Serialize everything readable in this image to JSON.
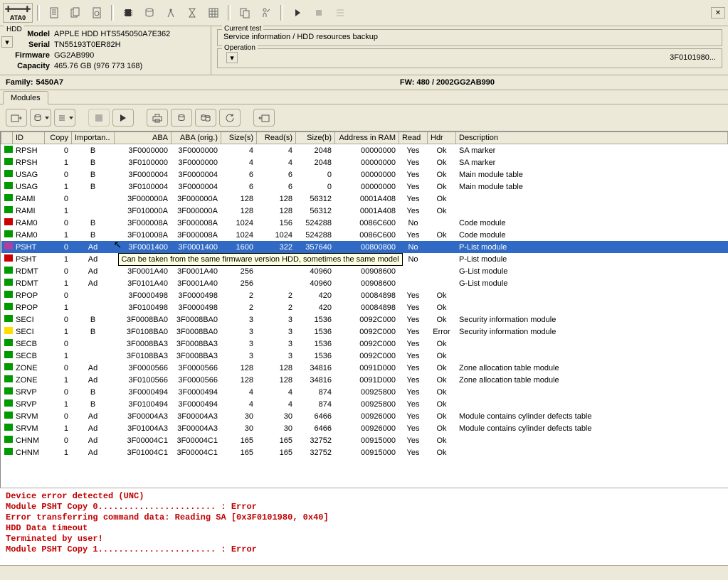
{
  "ata_btn": "ATA0",
  "hdd": {
    "label": "HDD",
    "model_k": "Model",
    "model": "APPLE HDD HTS545050A7E362",
    "serial_k": "Serial",
    "serial": "TN55193T0ER82H",
    "fw_k": "Firmware",
    "fw": "GG2AB990",
    "cap_k": "Capacity",
    "cap": "465.76 GB (976 773 168)"
  },
  "current_test": {
    "legend": "Current test",
    "value": "Service information / HDD resources backup"
  },
  "operation": {
    "legend": "Operation",
    "right": "3F0101980..."
  },
  "family": {
    "label": "Family:",
    "value": "5450A7",
    "fw_label": "FW:",
    "fw_value": "480 / 2002GG2AB990"
  },
  "tab_modules": "Modules",
  "columns": {
    "id": "ID",
    "copy": "Copy",
    "imp": "Importan..",
    "aba": "ABA",
    "abao": "ABA (orig.)",
    "ss": "Size(s)",
    "rs": "Read(s)",
    "sb": "Size(b)",
    "addr": "Address in RAM",
    "read": "Read",
    "hdr": "Hdr",
    "desc": "Description"
  },
  "tooltip": "Can be taken from the same firmware version HDD, sometimes the same model",
  "rows": [
    {
      "c": "green",
      "id": "RPSH",
      "copy": "0",
      "imp": "B",
      "aba": "3F0000000",
      "abao": "3F0000000",
      "ss": "4",
      "rs": "4",
      "sb": "2048",
      "addr": "00000000",
      "read": "Yes",
      "hdr": "Ok",
      "desc": "SA marker"
    },
    {
      "c": "green",
      "id": "RPSH",
      "copy": "1",
      "imp": "B",
      "aba": "3F0100000",
      "abao": "3F0000000",
      "ss": "4",
      "rs": "4",
      "sb": "2048",
      "addr": "00000000",
      "read": "Yes",
      "hdr": "Ok",
      "desc": "SA marker"
    },
    {
      "c": "green",
      "id": "USAG",
      "copy": "0",
      "imp": "B",
      "aba": "3F0000004",
      "abao": "3F0000004",
      "ss": "6",
      "rs": "6",
      "sb": "0",
      "addr": "00000000",
      "read": "Yes",
      "hdr": "Ok",
      "desc": "Main module table"
    },
    {
      "c": "green",
      "id": "USAG",
      "copy": "1",
      "imp": "B",
      "aba": "3F0100004",
      "abao": "3F0000004",
      "ss": "6",
      "rs": "6",
      "sb": "0",
      "addr": "00000000",
      "read": "Yes",
      "hdr": "Ok",
      "desc": "Main module table"
    },
    {
      "c": "green",
      "id": "RAMI",
      "copy": "0",
      "imp": "",
      "aba": "3F000000A",
      "abao": "3F000000A",
      "ss": "128",
      "rs": "128",
      "sb": "56312",
      "addr": "0001A408",
      "read": "Yes",
      "hdr": "Ok",
      "desc": ""
    },
    {
      "c": "green",
      "id": "RAMI",
      "copy": "1",
      "imp": "",
      "aba": "3F010000A",
      "abao": "3F000000A",
      "ss": "128",
      "rs": "128",
      "sb": "56312",
      "addr": "0001A408",
      "read": "Yes",
      "hdr": "Ok",
      "desc": ""
    },
    {
      "c": "red",
      "id": "RAM0",
      "copy": "0",
      "imp": "B",
      "aba": "3F000008A",
      "abao": "3F000008A",
      "ss": "1024",
      "rs": "156",
      "sb": "524288",
      "addr": "0086C600",
      "read": "No",
      "hdr": "",
      "desc": "Code module"
    },
    {
      "c": "green",
      "id": "RAM0",
      "copy": "1",
      "imp": "B",
      "aba": "3F010008A",
      "abao": "3F000008A",
      "ss": "1024",
      "rs": "1024",
      "sb": "524288",
      "addr": "0086C600",
      "read": "Yes",
      "hdr": "Ok",
      "desc": "Code module"
    },
    {
      "c": "purple",
      "id": "PSHT",
      "copy": "0",
      "imp": "Ad",
      "aba": "3F0001400",
      "abao": "3F0001400",
      "ss": "1600",
      "rs": "322",
      "sb": "357640",
      "addr": "00800800",
      "read": "No",
      "hdr": "",
      "desc": "P-List module",
      "sel": true
    },
    {
      "c": "red",
      "id": "PSHT",
      "copy": "1",
      "imp": "Ad",
      "aba": "",
      "abao": "",
      "ss": "",
      "rs": "",
      "sb": "",
      "addr": "",
      "read": "No",
      "hdr": "",
      "desc": "P-List module",
      "tooltip": true
    },
    {
      "c": "green",
      "id": "RDMT",
      "copy": "0",
      "imp": "Ad",
      "aba": "3F0001A40",
      "abao": "3F0001A40",
      "ss": "256",
      "rs": "",
      "sb": "40960",
      "addr": "00908600",
      "read": "",
      "hdr": "",
      "desc": "G-List module"
    },
    {
      "c": "green",
      "id": "RDMT",
      "copy": "1",
      "imp": "Ad",
      "aba": "3F0101A40",
      "abao": "3F0001A40",
      "ss": "256",
      "rs": "",
      "sb": "40960",
      "addr": "00908600",
      "read": "",
      "hdr": "",
      "desc": "G-List module"
    },
    {
      "c": "green",
      "id": "RPOP",
      "copy": "0",
      "imp": "",
      "aba": "3F0000498",
      "abao": "3F0000498",
      "ss": "2",
      "rs": "2",
      "sb": "420",
      "addr": "00084898",
      "read": "Yes",
      "hdr": "Ok",
      "desc": ""
    },
    {
      "c": "green",
      "id": "RPOP",
      "copy": "1",
      "imp": "",
      "aba": "3F0100498",
      "abao": "3F0000498",
      "ss": "2",
      "rs": "2",
      "sb": "420",
      "addr": "00084898",
      "read": "Yes",
      "hdr": "Ok",
      "desc": ""
    },
    {
      "c": "green",
      "id": "SECI",
      "copy": "0",
      "imp": "B",
      "aba": "3F0008BA0",
      "abao": "3F0008BA0",
      "ss": "3",
      "rs": "3",
      "sb": "1536",
      "addr": "0092C000",
      "read": "Yes",
      "hdr": "Ok",
      "desc": "Security information module"
    },
    {
      "c": "yellow",
      "id": "SECI",
      "copy": "1",
      "imp": "B",
      "aba": "3F0108BA0",
      "abao": "3F0008BA0",
      "ss": "3",
      "rs": "3",
      "sb": "1536",
      "addr": "0092C000",
      "read": "Yes",
      "hdr": "Error",
      "desc": "Security information module"
    },
    {
      "c": "green",
      "id": "SECB",
      "copy": "0",
      "imp": "",
      "aba": "3F0008BA3",
      "abao": "3F0008BA3",
      "ss": "3",
      "rs": "3",
      "sb": "1536",
      "addr": "0092C000",
      "read": "Yes",
      "hdr": "Ok",
      "desc": ""
    },
    {
      "c": "green",
      "id": "SECB",
      "copy": "1",
      "imp": "",
      "aba": "3F0108BA3",
      "abao": "3F0008BA3",
      "ss": "3",
      "rs": "3",
      "sb": "1536",
      "addr": "0092C000",
      "read": "Yes",
      "hdr": "Ok",
      "desc": ""
    },
    {
      "c": "green",
      "id": "ZONE",
      "copy": "0",
      "imp": "Ad",
      "aba": "3F0000566",
      "abao": "3F0000566",
      "ss": "128",
      "rs": "128",
      "sb": "34816",
      "addr": "0091D000",
      "read": "Yes",
      "hdr": "Ok",
      "desc": "Zone allocation table module"
    },
    {
      "c": "green",
      "id": "ZONE",
      "copy": "1",
      "imp": "Ad",
      "aba": "3F0100566",
      "abao": "3F0000566",
      "ss": "128",
      "rs": "128",
      "sb": "34816",
      "addr": "0091D000",
      "read": "Yes",
      "hdr": "Ok",
      "desc": "Zone allocation table module"
    },
    {
      "c": "green",
      "id": "SRVP",
      "copy": "0",
      "imp": "B",
      "aba": "3F0000494",
      "abao": "3F0000494",
      "ss": "4",
      "rs": "4",
      "sb": "874",
      "addr": "00925800",
      "read": "Yes",
      "hdr": "Ok",
      "desc": ""
    },
    {
      "c": "green",
      "id": "SRVP",
      "copy": "1",
      "imp": "B",
      "aba": "3F0100494",
      "abao": "3F0000494",
      "ss": "4",
      "rs": "4",
      "sb": "874",
      "addr": "00925800",
      "read": "Yes",
      "hdr": "Ok",
      "desc": ""
    },
    {
      "c": "green",
      "id": "SRVM",
      "copy": "0",
      "imp": "Ad",
      "aba": "3F00004A3",
      "abao": "3F00004A3",
      "ss": "30",
      "rs": "30",
      "sb": "6466",
      "addr": "00926000",
      "read": "Yes",
      "hdr": "Ok",
      "desc": "Module contains cylinder defects table"
    },
    {
      "c": "green",
      "id": "SRVM",
      "copy": "1",
      "imp": "Ad",
      "aba": "3F01004A3",
      "abao": "3F00004A3",
      "ss": "30",
      "rs": "30",
      "sb": "6466",
      "addr": "00926000",
      "read": "Yes",
      "hdr": "Ok",
      "desc": "Module contains cylinder defects table"
    },
    {
      "c": "green",
      "id": "CHNM",
      "copy": "0",
      "imp": "Ad",
      "aba": "3F00004C1",
      "abao": "3F00004C1",
      "ss": "165",
      "rs": "165",
      "sb": "32752",
      "addr": "00915000",
      "read": "Yes",
      "hdr": "Ok",
      "desc": ""
    },
    {
      "c": "green",
      "id": "CHNM",
      "copy": "1",
      "imp": "Ad",
      "aba": "3F01004C1",
      "abao": "3F00004C1",
      "ss": "165",
      "rs": "165",
      "sb": "32752",
      "addr": "00915000",
      "read": "Yes",
      "hdr": "Ok",
      "desc": ""
    }
  ],
  "log": [
    "Device error detected (UNC)",
    "Module PSHT Copy 0....................... : Error",
    "Error transferring command data: Reading SA [0x3F0101980, 0x40]",
    "HDD Data timeout",
    "Terminated by user!",
    "Module PSHT Copy 1....................... : Error"
  ]
}
